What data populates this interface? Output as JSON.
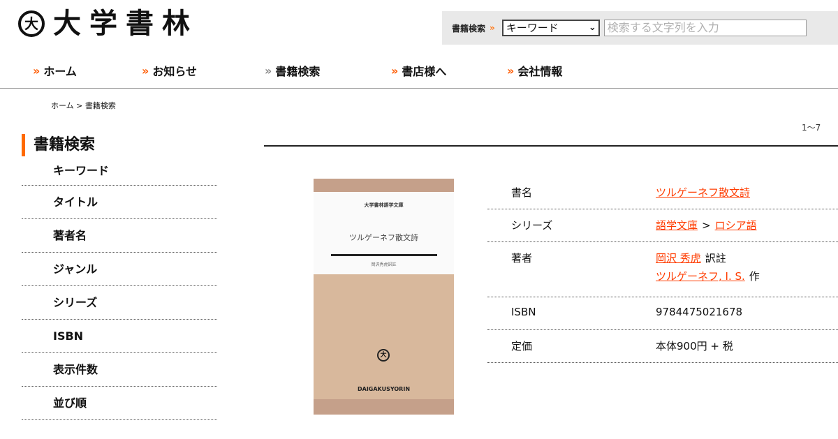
{
  "header": {
    "logo_mark": "大",
    "logo_text": "大学書林",
    "search": {
      "label": "書籍検索",
      "arrow": "»",
      "select_value": "キーワード",
      "input_placeholder": "検索する文字列を入力"
    }
  },
  "nav": {
    "items": [
      {
        "label": "ホーム",
        "arrow": "»"
      },
      {
        "label": "お知らせ",
        "arrow": "»"
      },
      {
        "label": "書籍検索",
        "arrow": "»"
      },
      {
        "label": "書店様へ",
        "arrow": "»"
      },
      {
        "label": "会社情報",
        "arrow": "»"
      }
    ]
  },
  "breadcrumb": "ホーム > 書籍検索",
  "sidebar": {
    "title": "書籍検索",
    "items": [
      "キーワード",
      "タイトル",
      "著者名",
      "ジャンル",
      "シリーズ",
      "ISBN",
      "表示件数",
      "並び順"
    ]
  },
  "results": {
    "count": "1～7"
  },
  "book": {
    "cover": {
      "series": "大学書林語学文庫",
      "title": "ツルゲーネフ散文詩",
      "author": "岡沢秀虎訳註",
      "emblem": "大",
      "publisher": "DAIGAKUSYORIN"
    },
    "labels": {
      "title": "書名",
      "series": "シリーズ",
      "author": "著者",
      "isbn": "ISBN",
      "price": "定価"
    },
    "title": "ツルゲーネフ散文詩",
    "series": [
      "語学文庫",
      "ロシア語"
    ],
    "series_sep": ">",
    "authors": [
      {
        "name": "岡沢 秀虎",
        "role": "訳註"
      },
      {
        "name": "ツルゲーネフ, I. S.",
        "role": "作"
      }
    ],
    "isbn": "9784475021678",
    "price": "本体900円 + 税"
  }
}
